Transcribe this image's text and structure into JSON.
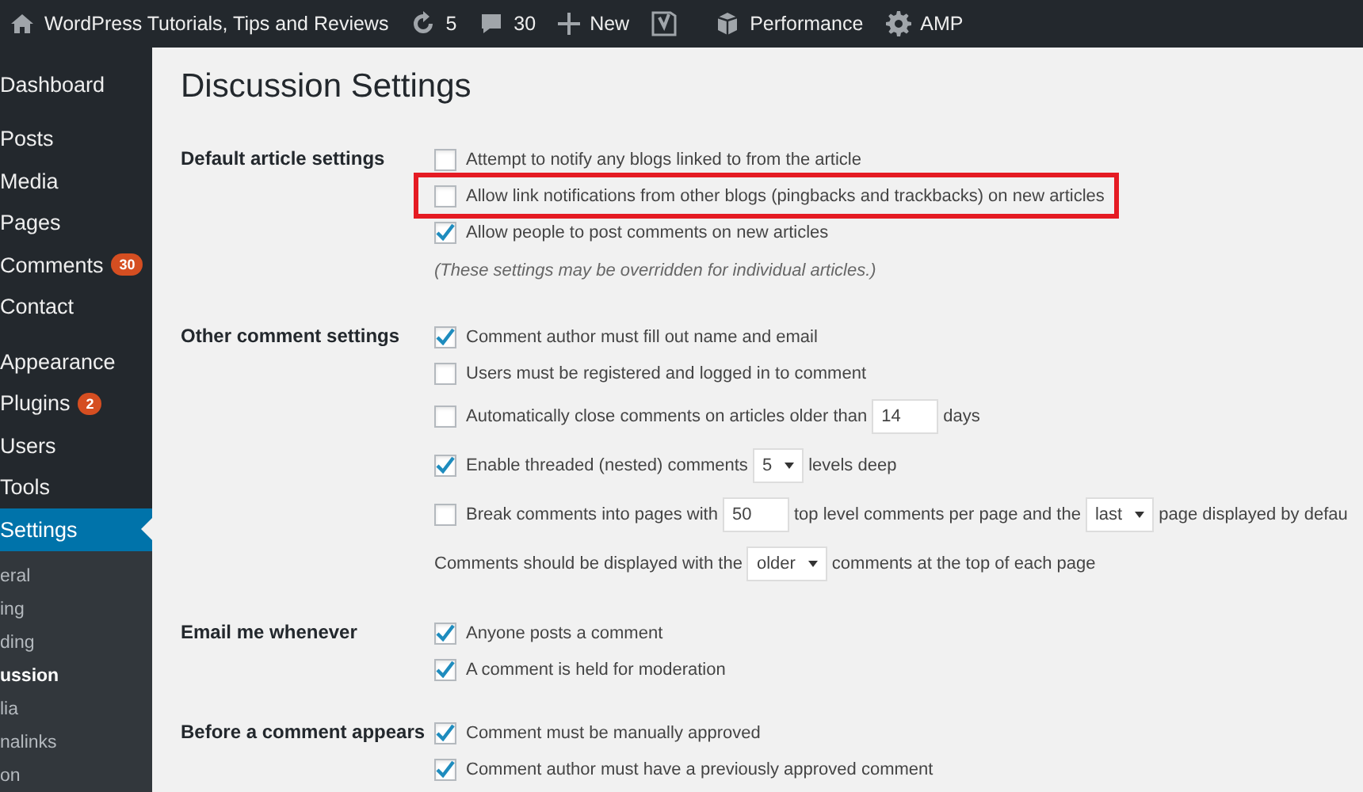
{
  "admin_bar": {
    "site_title": "WordPress Tutorials, Tips and Reviews",
    "updates": "5",
    "comments": "30",
    "new": "New",
    "performance": "Performance",
    "amp": "AMP"
  },
  "sidebar": {
    "items": [
      {
        "label": "Dashboard",
        "selected": false
      },
      {
        "label": "Posts",
        "selected": false
      },
      {
        "label": "Media",
        "selected": false
      },
      {
        "label": "Pages",
        "selected": false
      },
      {
        "label": "Comments",
        "selected": false,
        "badge": "30"
      },
      {
        "label": "Contact",
        "selected": false
      },
      {
        "label": "Appearance",
        "selected": false
      },
      {
        "label": "Plugins",
        "selected": false,
        "badge": "2"
      },
      {
        "label": "Users",
        "selected": false
      },
      {
        "label": "Tools",
        "selected": false
      },
      {
        "label": "Settings",
        "selected": true
      }
    ],
    "submenu": [
      {
        "label": "eral",
        "selected": false
      },
      {
        "label": "ing",
        "selected": false
      },
      {
        "label": "ding",
        "selected": false
      },
      {
        "label": "ussion",
        "selected": true
      },
      {
        "label": "lia",
        "selected": false
      },
      {
        "label": "nalinks",
        "selected": false
      },
      {
        "label": "on",
        "selected": false
      }
    ]
  },
  "page_title": "Discussion Settings",
  "sections": [
    {
      "label": "Default article settings",
      "items": [
        {
          "kind": "checkbox",
          "checked": false,
          "highlighted": false,
          "parts": [
            {
              "kind": "text",
              "text": "Attempt to notify any blogs linked to from the article"
            }
          ]
        },
        {
          "kind": "checkbox",
          "checked": false,
          "highlighted": true,
          "parts": [
            {
              "kind": "text",
              "text": "Allow link notifications from other blogs (pingbacks and trackbacks) on new articles"
            }
          ]
        },
        {
          "kind": "checkbox",
          "checked": true,
          "highlighted": false,
          "parts": [
            {
              "kind": "text",
              "text": "Allow people to post comments on new articles"
            }
          ]
        },
        {
          "kind": "note",
          "text": "(These settings may be overridden for individual articles.)"
        }
      ]
    },
    {
      "label": "Other comment settings",
      "items": [
        {
          "kind": "checkbox",
          "checked": true,
          "highlighted": false,
          "parts": [
            {
              "kind": "text",
              "text": "Comment author must fill out name and email"
            }
          ]
        },
        {
          "kind": "checkbox",
          "checked": false,
          "highlighted": false,
          "parts": [
            {
              "kind": "text",
              "text": "Users must be registered and logged in to comment"
            }
          ]
        },
        {
          "kind": "checkbox",
          "checked": false,
          "highlighted": false,
          "parts": [
            {
              "kind": "text",
              "text": "Automatically close comments on articles older than"
            },
            {
              "kind": "input",
              "value": "14"
            },
            {
              "kind": "text",
              "text": "days"
            }
          ]
        },
        {
          "kind": "checkbox",
          "checked": true,
          "highlighted": false,
          "parts": [
            {
              "kind": "text",
              "text": "Enable threaded (nested) comments"
            },
            {
              "kind": "select",
              "value": "5"
            },
            {
              "kind": "text",
              "text": "levels deep"
            }
          ]
        },
        {
          "kind": "checkbox",
          "checked": false,
          "highlighted": false,
          "parts": [
            {
              "kind": "text",
              "text": "Break comments into pages with"
            },
            {
              "kind": "input",
              "value": "50"
            },
            {
              "kind": "text",
              "text": "top level comments per page and the"
            },
            {
              "kind": "select",
              "value": "last"
            },
            {
              "kind": "text",
              "text": "page displayed by defau"
            }
          ]
        },
        {
          "kind": "line",
          "parts": [
            {
              "kind": "text",
              "text": "Comments should be displayed with the"
            },
            {
              "kind": "select",
              "value": "older"
            },
            {
              "kind": "text",
              "text": "comments at the top of each page"
            }
          ]
        }
      ]
    },
    {
      "label": "Email me whenever",
      "items": [
        {
          "kind": "checkbox",
          "checked": true,
          "highlighted": false,
          "parts": [
            {
              "kind": "text",
              "text": "Anyone posts a comment"
            }
          ]
        },
        {
          "kind": "checkbox",
          "checked": true,
          "highlighted": false,
          "parts": [
            {
              "kind": "text",
              "text": "A comment is held for moderation"
            }
          ]
        }
      ]
    },
    {
      "label": "Before a comment appears",
      "items": [
        {
          "kind": "checkbox",
          "checked": true,
          "highlighted": false,
          "parts": [
            {
              "kind": "text",
              "text": "Comment must be manually approved"
            }
          ]
        },
        {
          "kind": "checkbox",
          "checked": true,
          "highlighted": false,
          "parts": [
            {
              "kind": "text",
              "text": "Comment author must have a previously approved comment"
            }
          ]
        }
      ]
    }
  ]
}
